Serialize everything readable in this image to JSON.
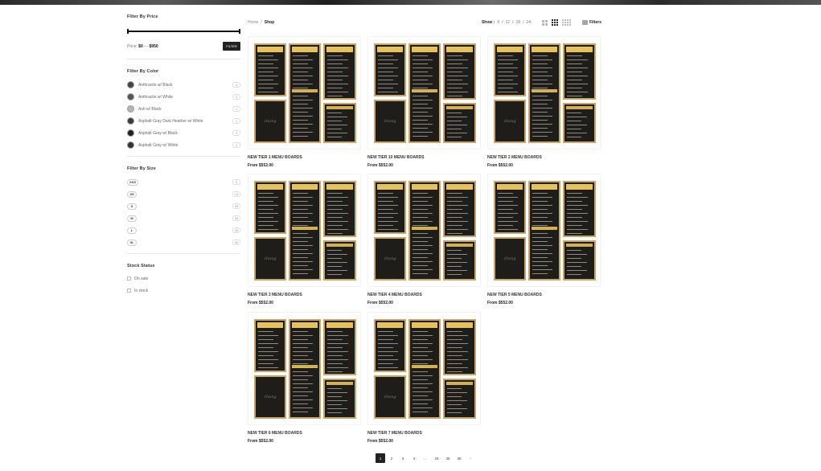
{
  "breadcrumb": {
    "home": "Home",
    "sep": "/",
    "current": "Shop"
  },
  "toolbar": {
    "show_label": "Show :",
    "show_options": [
      "9",
      "12",
      "18",
      "24"
    ],
    "separator": "/",
    "filters_label": "Filters"
  },
  "sidebar": {
    "price": {
      "title": "Filter By Price",
      "label": "Price:",
      "min": "$0",
      "dash": "—",
      "max": "$950",
      "button": "FILTER"
    },
    "color": {
      "title": "Filter By Color",
      "items": [
        {
          "label": "Anthracite w/ Black",
          "count": "4",
          "swatch": "#444444"
        },
        {
          "label": "Anthracite w/ White",
          "count": "2",
          "swatch": "#555555"
        },
        {
          "label": "Ash w/ Black",
          "count": "1",
          "swatch": "#b5b5b5"
        },
        {
          "label": "Asphalt Gray Dark Heather w/ White",
          "count": "1",
          "swatch": "#3b3b3b"
        },
        {
          "label": "Asphalt Gray w/ Black",
          "count": "2",
          "swatch": "#222222"
        },
        {
          "label": "Asphalt Gray w/ White",
          "count": "1",
          "swatch": "#333333"
        }
      ]
    },
    "size": {
      "title": "Filter By Size",
      "items": [
        {
          "label": "XXS",
          "count": "2"
        },
        {
          "label": "XS",
          "count": "15"
        },
        {
          "label": "S",
          "count": "35"
        },
        {
          "label": "M",
          "count": "35"
        },
        {
          "label": "L",
          "count": "36"
        },
        {
          "label": "XL",
          "count": "36"
        }
      ]
    },
    "stock": {
      "title": "Stock Status",
      "items": [
        "On sale",
        "In stock"
      ]
    }
  },
  "products": [
    {
      "title": "NEW TIER 1 MENU BOARDS",
      "price_label": "From",
      "price": "$552.00"
    },
    {
      "title": "NEW TIER 10 MENU BOARDS",
      "price_label": "From",
      "price": "$552.00"
    },
    {
      "title": "NEW TIER 2 MENU BOARDS",
      "price_label": "From",
      "price": "$552.00"
    },
    {
      "title": "NEW TIER 3 MENU BOARDS",
      "price_label": "From",
      "price": "$552.00"
    },
    {
      "title": "NEW TIER 4 MENU BOARDS",
      "price_label": "From",
      "price": "$552.00"
    },
    {
      "title": "NEW TIER 5 MENU BOARDS",
      "price_label": "From",
      "price": "$552.00"
    },
    {
      "title": "NEW TIER 6 MENU BOARDS",
      "price_label": "From",
      "price": "$552.00"
    },
    {
      "title": "NEW TIER 7 MENU BOARDS",
      "price_label": "From",
      "price": "$552.00"
    }
  ],
  "pagination": {
    "pages": [
      "1",
      "2",
      "3",
      "4",
      "…",
      "34",
      "35",
      "36",
      "›"
    ],
    "active": "1"
  },
  "colors": {
    "board_bg": "#1e1d1a",
    "board_gold": "#e6c25a",
    "board_border": "#c9a56a",
    "active_page": "#222222"
  }
}
